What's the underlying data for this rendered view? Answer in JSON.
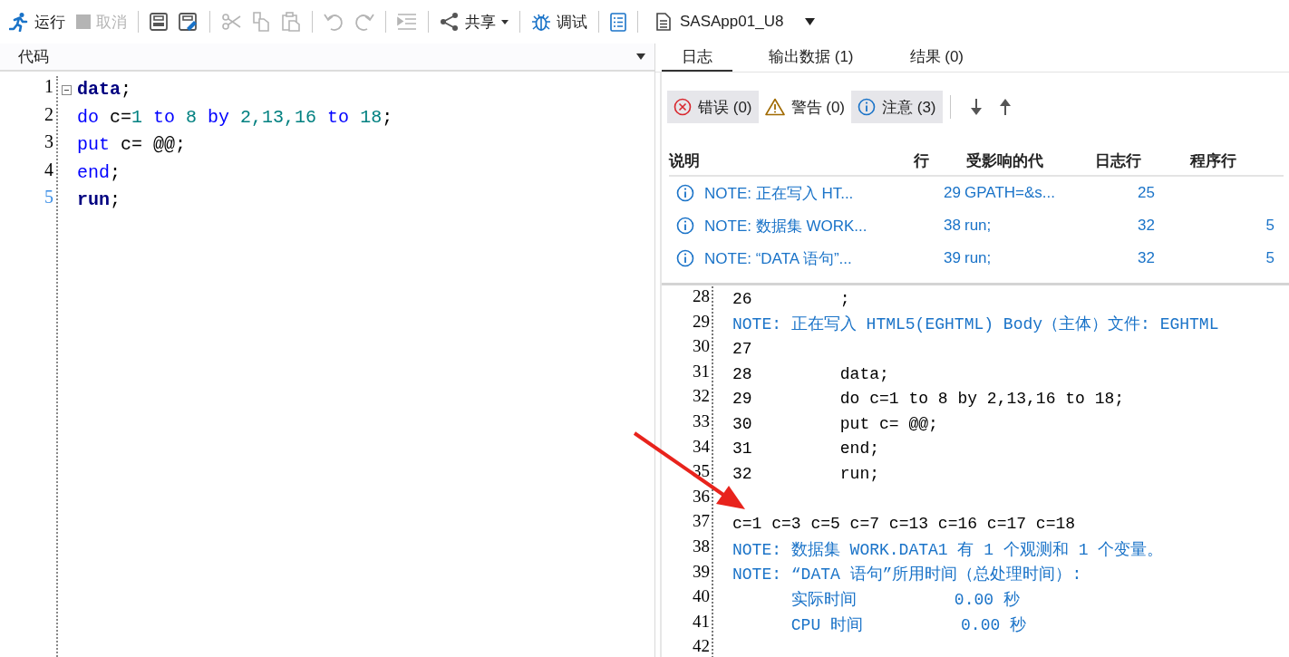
{
  "toolbar": {
    "items": [
      {
        "kind": "run",
        "label": "运行",
        "disabled": false
      },
      {
        "kind": "cancel",
        "label": "取消",
        "disabled": true
      },
      {
        "kind": "separator"
      },
      {
        "kind": "save",
        "disabled": false
      },
      {
        "kind": "save-as",
        "disabled": false
      },
      {
        "kind": "separator"
      },
      {
        "kind": "cut",
        "disabled": true
      },
      {
        "kind": "copy",
        "disabled": true
      },
      {
        "kind": "paste",
        "disabled": true
      },
      {
        "kind": "separator"
      },
      {
        "kind": "undo",
        "disabled": true
      },
      {
        "kind": "redo",
        "disabled": true
      },
      {
        "kind": "separator"
      },
      {
        "kind": "indent",
        "disabled": true
      },
      {
        "kind": "separator"
      },
      {
        "kind": "share",
        "label": "共享",
        "disabled": false
      },
      {
        "kind": "separator"
      },
      {
        "kind": "debug",
        "label": "调试",
        "disabled": false
      },
      {
        "kind": "separator"
      },
      {
        "kind": "properties",
        "disabled": false
      },
      {
        "kind": "separator"
      },
      {
        "kind": "server",
        "label": "SASApp01_U8",
        "disabled": false
      }
    ]
  },
  "code_panel": {
    "title": "代码",
    "lines": [
      {
        "number": "1",
        "current": false,
        "collapsible": true,
        "tokens": [
          {
            "text": "data",
            "kind": "step"
          },
          {
            "text": ";",
            "kind": "plain"
          }
        ]
      },
      {
        "number": "2",
        "current": false,
        "collapsible": false,
        "tokens": [
          {
            "text": "do",
            "kind": "keyword"
          },
          {
            "text": " c=",
            "kind": "plain"
          },
          {
            "text": "1",
            "kind": "number"
          },
          {
            "text": " to",
            "kind": "keyword"
          },
          {
            "text": " 8",
            "kind": "number"
          },
          {
            "text": " by",
            "kind": "keyword"
          },
          {
            "text": " 2,13,16",
            "kind": "number"
          },
          {
            "text": " to",
            "kind": "keyword"
          },
          {
            "text": " 18",
            "kind": "number"
          },
          {
            "text": ";",
            "kind": "plain"
          }
        ]
      },
      {
        "number": "3",
        "current": false,
        "collapsible": false,
        "tokens": [
          {
            "text": "put",
            "kind": "keyword"
          },
          {
            "text": " c= @@;",
            "kind": "plain"
          }
        ]
      },
      {
        "number": "4",
        "current": false,
        "collapsible": false,
        "tokens": [
          {
            "text": "end",
            "kind": "keyword"
          },
          {
            "text": ";",
            "kind": "plain"
          }
        ]
      },
      {
        "number": "5",
        "current": true,
        "collapsible": false,
        "tokens": [
          {
            "text": "run",
            "kind": "step"
          },
          {
            "text": ";",
            "kind": "plain"
          }
        ]
      }
    ]
  },
  "results_panel": {
    "tabs": [
      {
        "label": "日志",
        "selected": true
      },
      {
        "label": "输出数据 (1)",
        "selected": false
      },
      {
        "label": "结果 (0)",
        "selected": false
      }
    ],
    "filters": [
      {
        "kind": "error",
        "label": "错误 (0)",
        "selected": true
      },
      {
        "kind": "warning",
        "label": "警告 (0)",
        "selected": false
      },
      {
        "kind": "note",
        "label": "注意 (3)",
        "selected": true
      }
    ],
    "table": {
      "columns": [
        "说明",
        "行",
        "受影响的代",
        "日志行",
        "程序行"
      ],
      "rows": [
        {
          "description": "NOTE: 正在写入 HT...",
          "line": "29",
          "code": "GPATH=&s...",
          "log_line": "25"
        },
        {
          "description": "NOTE: 数据集 WORK...",
          "line": "38",
          "code": "run;",
          "log_line": "32",
          "program_line": "5"
        },
        {
          "description": "NOTE: “DATA 语句”...",
          "line": "39",
          "code": "run;",
          "log_line": "32",
          "program_line": "5"
        }
      ]
    },
    "log": [
      {
        "number": "28",
        "kind": "source",
        "text": "26         ;"
      },
      {
        "number": "29",
        "kind": "note",
        "text": "NOTE: 正在写入 HTML5(EGHTML) Body（主体）文件: EGHTML"
      },
      {
        "number": "30",
        "kind": "source",
        "text": "27"
      },
      {
        "number": "31",
        "kind": "source",
        "text": "28         data;"
      },
      {
        "number": "32",
        "kind": "source",
        "text": "29         do c=1 to 8 by 2,13,16 to 18;"
      },
      {
        "number": "33",
        "kind": "source",
        "text": "30         put c= @@;"
      },
      {
        "number": "34",
        "kind": "source",
        "text": "31         end;"
      },
      {
        "number": "35",
        "kind": "source",
        "text": "32         run;"
      },
      {
        "number": "36",
        "kind": "blank"
      },
      {
        "number": "37",
        "kind": "source",
        "text": "c=1 c=3 c=5 c=7 c=13 c=16 c=17 c=18"
      },
      {
        "number": "38",
        "kind": "note",
        "text": "NOTE: 数据集 WORK.DATA1 有 1 个观测和 1 个变量。"
      },
      {
        "number": "39",
        "kind": "note",
        "text": "NOTE: “DATA 语句”所用时间（总处理时间）:"
      },
      {
        "number": "40",
        "kind": "note",
        "text": "      实际时间          0.00 秒"
      },
      {
        "number": "41",
        "kind": "note",
        "text": "      CPU 时间          0.00 秒"
      },
      {
        "number": "42",
        "kind": "blank"
      }
    ]
  }
}
